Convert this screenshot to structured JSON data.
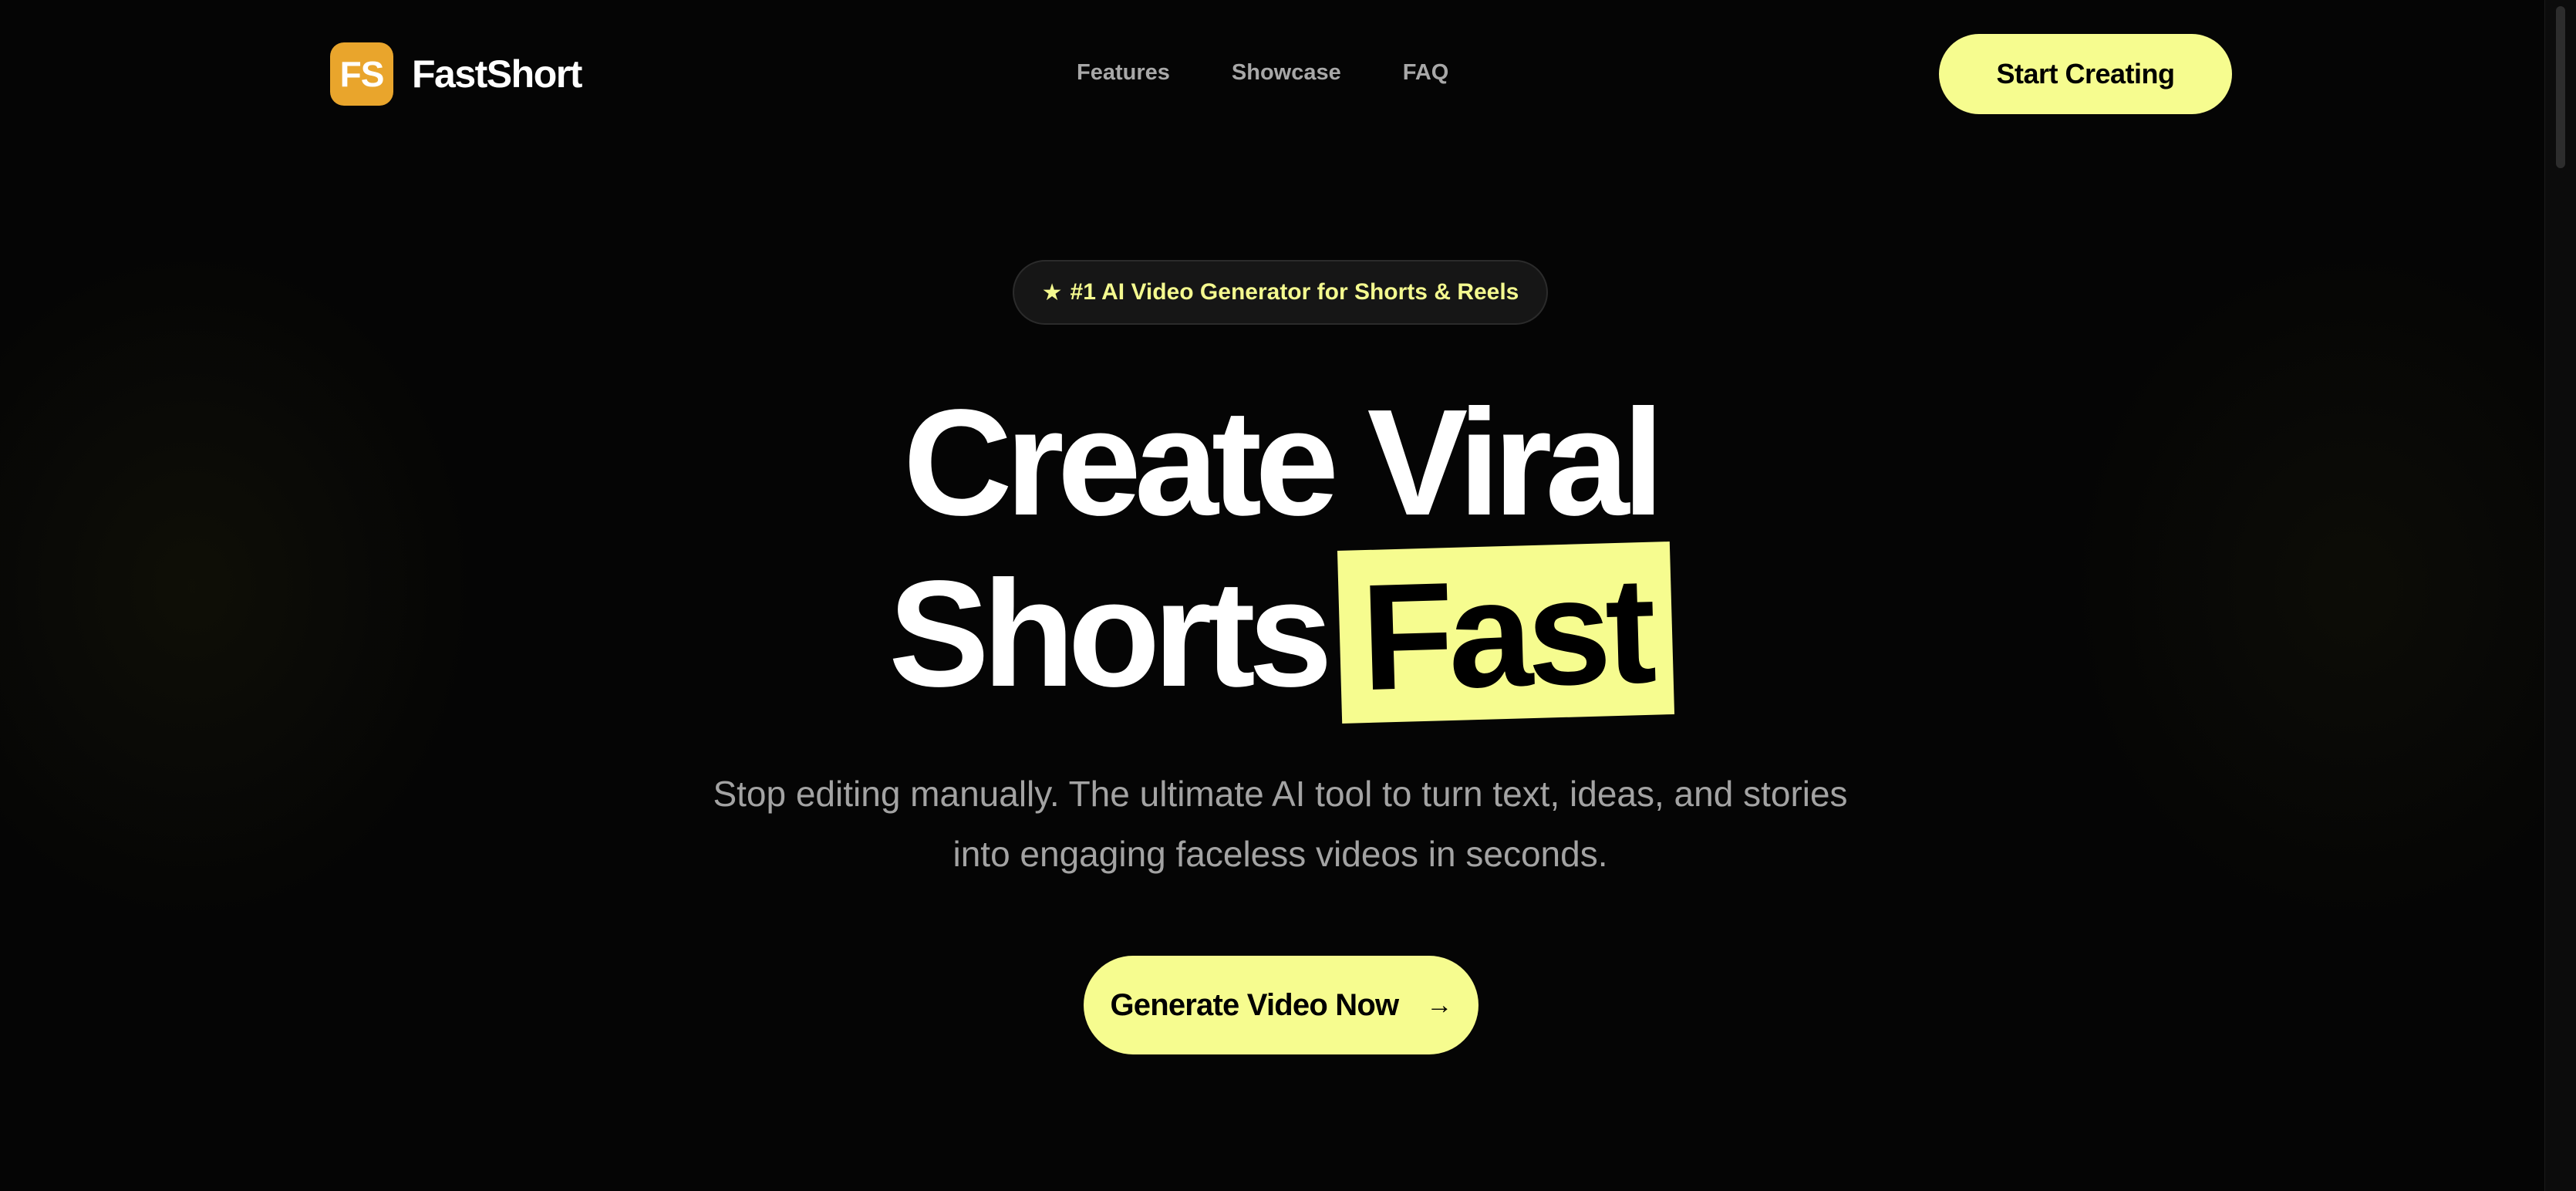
{
  "header": {
    "logo_mark": "FS",
    "brand_name": "FastShort",
    "nav": [
      {
        "label": "Features"
      },
      {
        "label": "Showcase"
      },
      {
        "label": "FAQ"
      }
    ],
    "cta_label": "Start Creating"
  },
  "hero": {
    "badge_icon": "★",
    "badge_text": "#1 AI Video Generator for Shorts & Reels",
    "headline_line1": "Create Viral",
    "headline_line2_plain": "Shorts",
    "headline_line2_highlight": "Fast",
    "subtitle_line1": "Stop editing manually. The ultimate AI tool to turn text, ideas, and stories",
    "subtitle_line2": "into engaging faceless videos in seconds.",
    "cta_label": "Generate Video Now",
    "cta_icon": "→"
  },
  "colors": {
    "background": "#050505",
    "accent": "#f6fc8f",
    "logo": "#e9a52c",
    "muted_text": "#a3a3a3"
  }
}
